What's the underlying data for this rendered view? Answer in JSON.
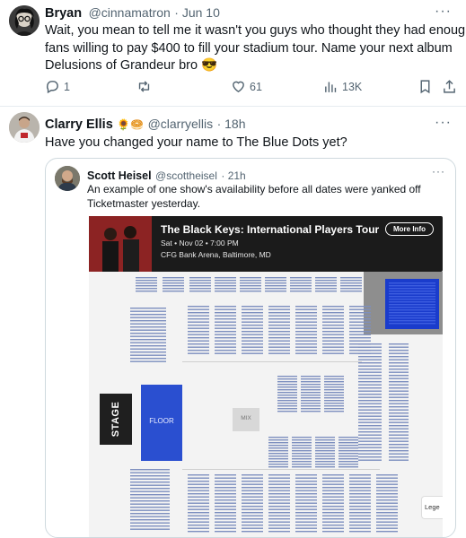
{
  "reply1": {
    "name": "Bryan",
    "handle": "@cinnamatron",
    "date": "· Jun 10",
    "more": "···",
    "text_line1": "Wait, you mean to tell me it wasn't you guys who thought they had enough",
    "text_line2": "fans willing to pay $400 to fill your stadium tour. Name your next album",
    "text_line3": "Delusions of Grandeur bro 😎",
    "actions": {
      "reply_count": "1",
      "retweet_count": "",
      "like_count": "61",
      "view_count": "13K"
    }
  },
  "reply2": {
    "name": "Clarry Ellis",
    "name_emoji": "🌻🥯",
    "handle": "@clarryellis",
    "date": "· 18h",
    "more": "···",
    "text": "Have you changed your name to The Blue Dots yet?"
  },
  "quote": {
    "name": "Scott Heisel",
    "handle": "@scottheisel",
    "date": "· 21h",
    "more": "···",
    "text_line1": "An example of one show's availability before all dates were yanked off",
    "text_line2": "Ticketmaster yesterday."
  },
  "ticketmaster": {
    "event_title": "The Black Keys: International Players Tour",
    "date_time": "Sat • Nov 02 • 7:00 PM",
    "venue": "CFG Bank Arena, Baltimore, MD",
    "more_info_button": "More Info",
    "stage_label": "STAGE",
    "floor_label": "FLOOR",
    "mix_label": "MIX",
    "legend_label": "Lege"
  },
  "colors": {
    "text_primary": "#0f1419",
    "text_secondary": "#536471",
    "border": "#cfd9de",
    "floor_blue": "#2a4fd0",
    "seat_blue": "#7d8fbf",
    "available_blue": "#1a3ccc",
    "header_dark": "#1b1b1b"
  },
  "icons": [
    "reply-icon",
    "retweet-icon",
    "like-icon",
    "views-icon",
    "bookmark-icon",
    "share-icon",
    "more-icon"
  ]
}
